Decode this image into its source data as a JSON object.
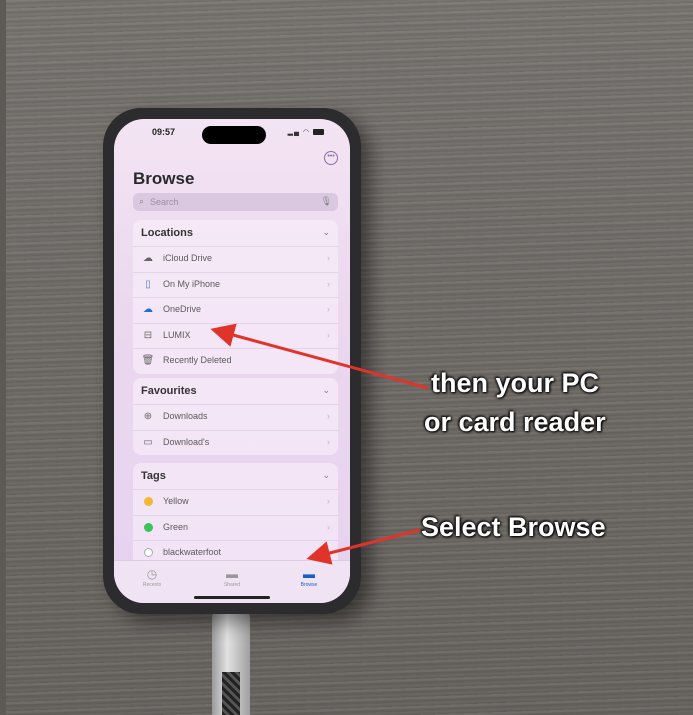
{
  "status": {
    "time": "09:57"
  },
  "screen": {
    "title": "Browse",
    "search_placeholder": "Search",
    "sections": [
      {
        "label": "Locations",
        "items": [
          {
            "label": "iCloud Drive",
            "icon": "cloud-icon"
          },
          {
            "label": "On My iPhone",
            "icon": "phone-icon"
          },
          {
            "label": "OneDrive",
            "icon": "onedrive-icon"
          },
          {
            "label": "LUMIX",
            "icon": "drive-icon"
          },
          {
            "label": "Recently Deleted",
            "icon": "trash-icon"
          }
        ]
      },
      {
        "label": "Favourites",
        "items": [
          {
            "label": "Downloads",
            "icon": "download-icon"
          },
          {
            "label": "Download's",
            "icon": "folder-icon"
          }
        ]
      },
      {
        "label": "Tags",
        "items": [
          {
            "label": "Yellow",
            "icon": "yellow-tag-dot",
            "color": "#f5b731"
          },
          {
            "label": "Green",
            "icon": "green-tag-dot",
            "color": "#39c45b"
          },
          {
            "label": "blackwaterfoot",
            "icon": "empty-tag-dot",
            "color": "#ffffff"
          }
        ]
      }
    ],
    "tabs": [
      {
        "label": "Recents",
        "icon": "clock-icon",
        "active": false
      },
      {
        "label": "Shared",
        "icon": "shared-folder-icon",
        "active": false
      },
      {
        "label": "Browse",
        "icon": "folder-icon",
        "active": true
      }
    ]
  },
  "annotations": {
    "pc_line1": "then your PC",
    "pc_line2": "or card reader",
    "browse": "Select Browse",
    "arrow_color": "#e0342a"
  }
}
